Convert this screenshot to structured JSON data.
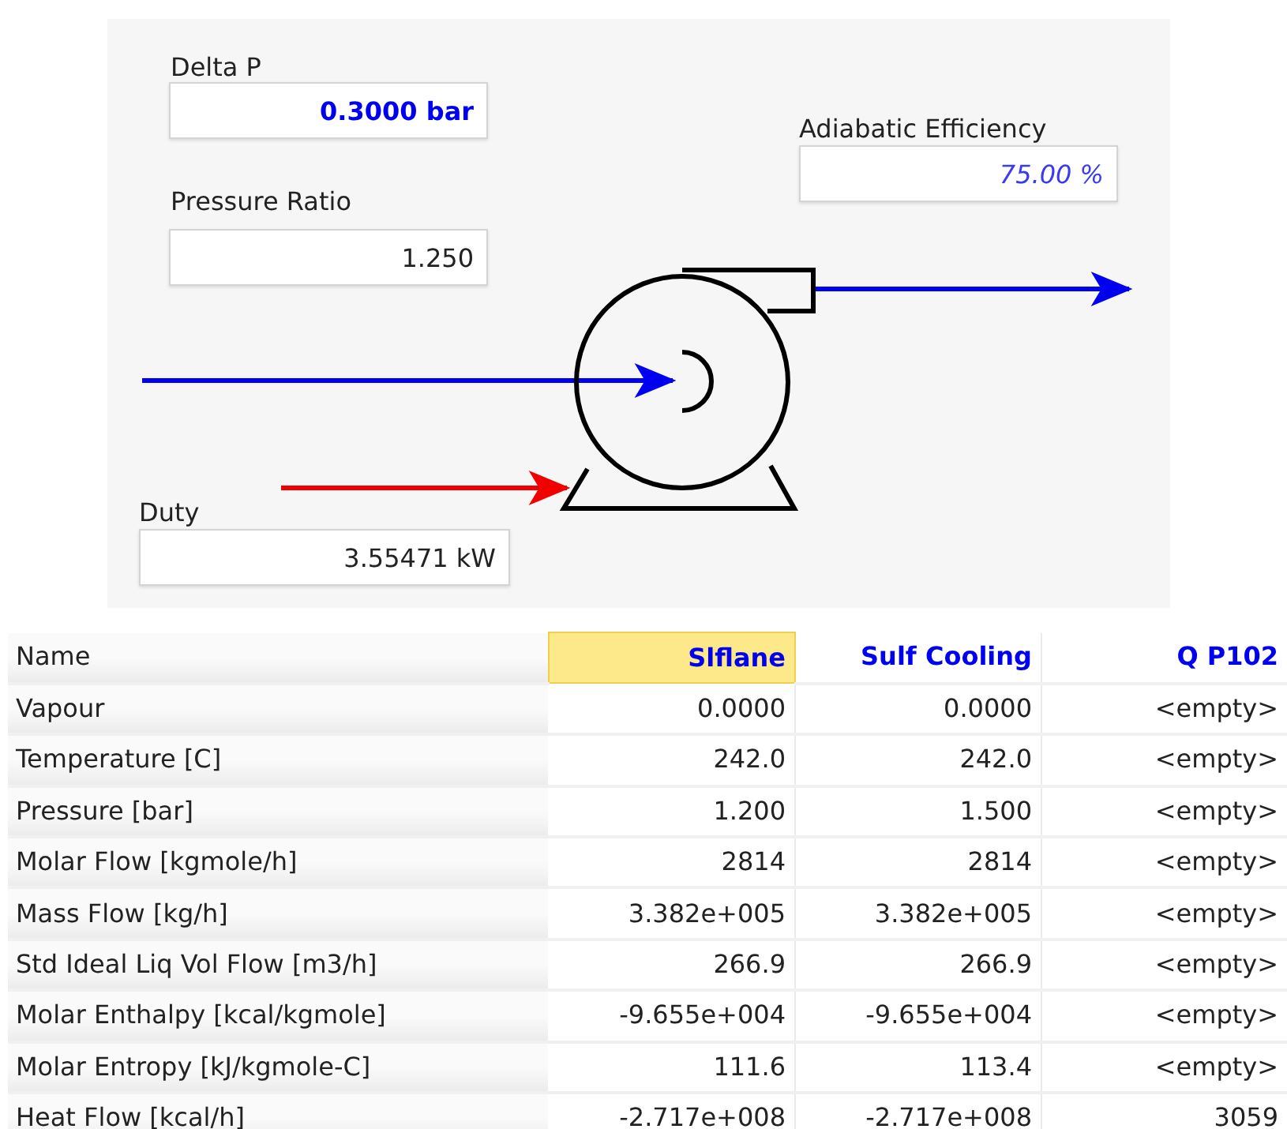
{
  "pump_panel": {
    "fields": [
      {
        "label": "Delta P",
        "value": "0.3000 bar",
        "kind": "specified"
      },
      {
        "label": "Pressure Ratio",
        "value": "1.250",
        "kind": "calculated"
      },
      {
        "label": "Adiabatic Efficiency",
        "value": "75.00 %",
        "kind": "default"
      },
      {
        "label": "Duty",
        "value": "3.55471 kW",
        "kind": "calculated"
      }
    ]
  },
  "table": {
    "columns": [
      {
        "label": "Name",
        "selected": false
      },
      {
        "label": "Slflane",
        "selected": true
      },
      {
        "label": "Sulf Cooling",
        "selected": false
      },
      {
        "label": "Q P102",
        "selected": false
      }
    ],
    "rows": [
      {
        "name": "Vapour",
        "values": [
          "0.0000",
          "0.0000",
          "<empty>"
        ]
      },
      {
        "name": "Temperature [C]",
        "values": [
          "242.0",
          "242.0",
          "<empty>"
        ]
      },
      {
        "name": "Pressure [bar]",
        "values": [
          "1.200",
          "1.500",
          "<empty>"
        ]
      },
      {
        "name": "Molar Flow [kgmole/h]",
        "values": [
          "2814",
          "2814",
          "<empty>"
        ]
      },
      {
        "name": "Mass Flow [kg/h]",
        "values": [
          "3.382e+005",
          "3.382e+005",
          "<empty>"
        ]
      },
      {
        "name": "Std Ideal Liq Vol Flow [m3/h]",
        "values": [
          "266.9",
          "266.9",
          "<empty>"
        ]
      },
      {
        "name": "Molar Enthalpy [kcal/kgmole]",
        "values": [
          "-9.655e+004",
          "-9.655e+004",
          "<empty>"
        ]
      },
      {
        "name": "Molar Entropy [kJ/kgmole-C]",
        "values": [
          "111.6",
          "113.4",
          "<empty>"
        ]
      },
      {
        "name": "Heat Flow [kcal/h]",
        "values": [
          "-2.717e+008",
          "-2.717e+008",
          "3059"
        ]
      }
    ]
  }
}
